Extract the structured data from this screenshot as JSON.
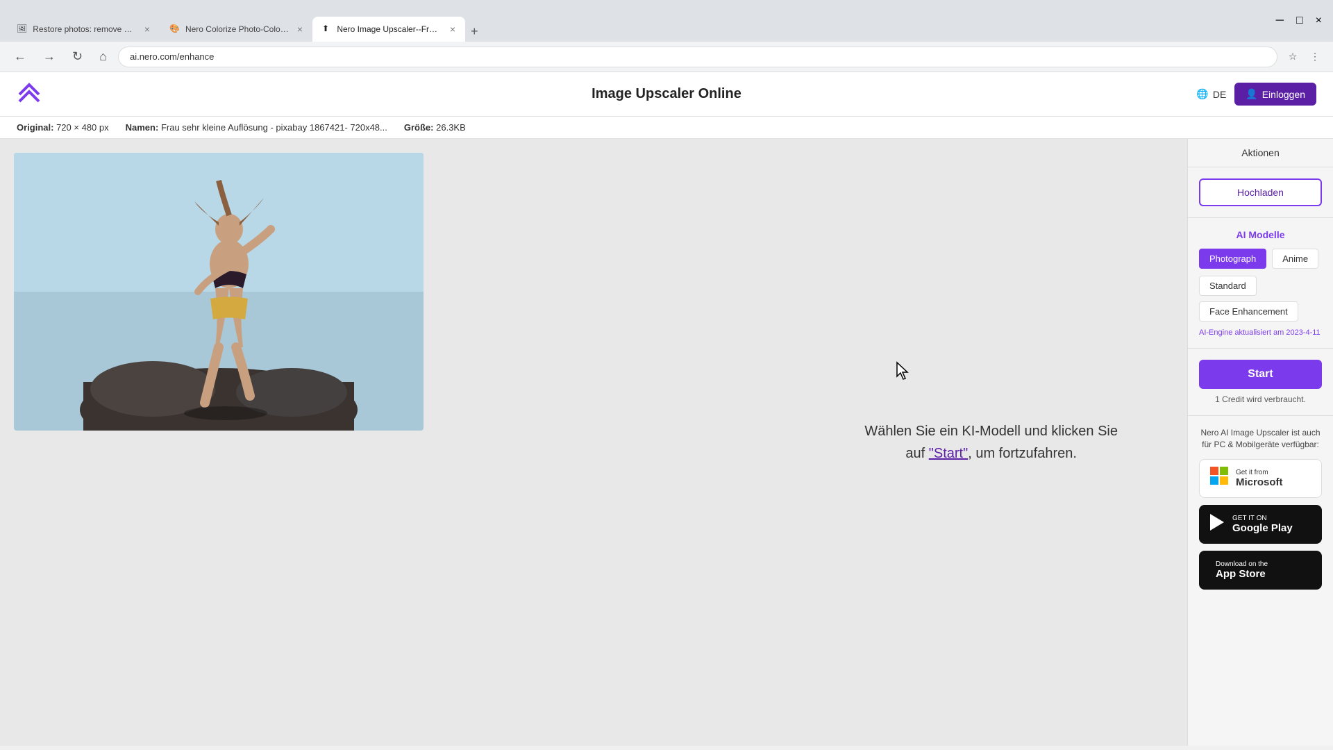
{
  "browser": {
    "tabs": [
      {
        "id": "tab1",
        "label": "Restore photos: remove scrat...",
        "favicon": "🖼",
        "active": false
      },
      {
        "id": "tab2",
        "label": "Nero Colorize Photo-Colorize Yo...",
        "favicon": "🎨",
        "active": false
      },
      {
        "id": "tab3",
        "label": "Nero Image Upscaler--Free Pho...",
        "favicon": "⬆",
        "active": true
      }
    ],
    "address": "ai.nero.com/enhance",
    "new_tab_label": "+"
  },
  "header": {
    "title": "Image Upscaler Online",
    "lang_label": "DE",
    "login_label": "Einloggen"
  },
  "info_bar": {
    "original_label": "Original:",
    "original_value": "720 × 480 px",
    "name_label": "Namen:",
    "name_value": "Frau sehr kleine Auflösung - pixabay 1867421- 720x48...",
    "size_label": "Größe:",
    "size_value": "26.3KB"
  },
  "sidebar": {
    "header_label": "Aktionen",
    "upload_label": "Hochladen",
    "ai_models_title": "AI Modelle",
    "models": [
      {
        "id": "photograph",
        "label": "Photograph",
        "active": true
      },
      {
        "id": "anime",
        "label": "Anime",
        "active": false
      },
      {
        "id": "standard",
        "label": "Standard",
        "active": false
      },
      {
        "id": "face_enhancement",
        "label": "Face Enhancement",
        "active": false
      }
    ],
    "engine_text": "AI-Engine aktualisiert am 2023-4-11",
    "start_label": "Start",
    "credit_text": "1 Credit wird verbraucht.",
    "store_section_text": "Nero AI Image Upscaler ist auch für PC & Mobilgeräte verfügbar:",
    "stores": [
      {
        "id": "microsoft",
        "get_text": "Get it from",
        "name_text": "Microsoft",
        "icon": "⊞"
      },
      {
        "id": "google_play",
        "get_text": "GET IT ON",
        "name_text": "Google Play",
        "icon": "▶"
      },
      {
        "id": "app_store",
        "get_text": "Download on the",
        "name_text": "App Store",
        "icon": ""
      }
    ]
  },
  "main": {
    "instruction_text_1": "Wählen Sie ein KI-Modell und klicken Sie",
    "instruction_text_2": "auf ",
    "instruction_link": "\"Start\"",
    "instruction_text_3": ", um fortzufahren."
  }
}
